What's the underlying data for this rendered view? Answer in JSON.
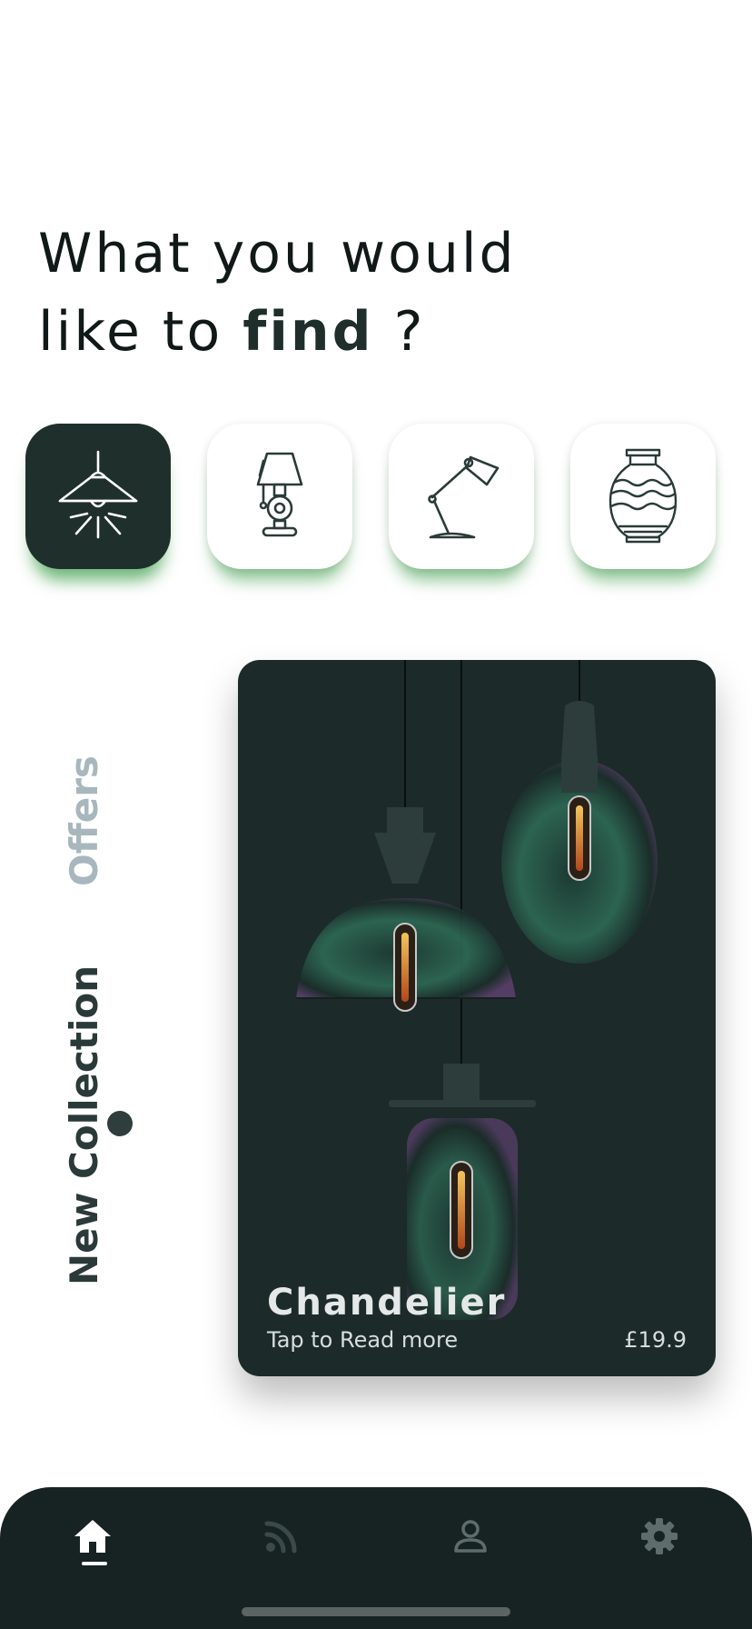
{
  "heading": {
    "line1": "What you would",
    "line2_prefix": "like to ",
    "line2_emphasis": "find",
    "line2_suffix": " ?"
  },
  "categories": [
    {
      "icon": "ceiling-lamp-icon",
      "selected": true
    },
    {
      "icon": "table-lamp-icon",
      "selected": false
    },
    {
      "icon": "desk-lamp-icon",
      "selected": false
    },
    {
      "icon": "vase-icon",
      "selected": false
    }
  ],
  "collection_tabs": [
    {
      "label": "Offers",
      "active": false
    },
    {
      "label": "New Collection",
      "active": true
    }
  ],
  "featured": {
    "title": "Chandelier",
    "subtitle": "Tap to Read more",
    "price": "£19.9"
  },
  "nav": {
    "items": [
      "home-icon",
      "feed-icon",
      "profile-icon",
      "settings-icon"
    ],
    "active": "home-icon"
  },
  "colors": {
    "dark": "#1f2f2c",
    "card": "#1c2a29",
    "accent_glow": "#2e963c",
    "muted_tab": "#a7b7bd"
  }
}
